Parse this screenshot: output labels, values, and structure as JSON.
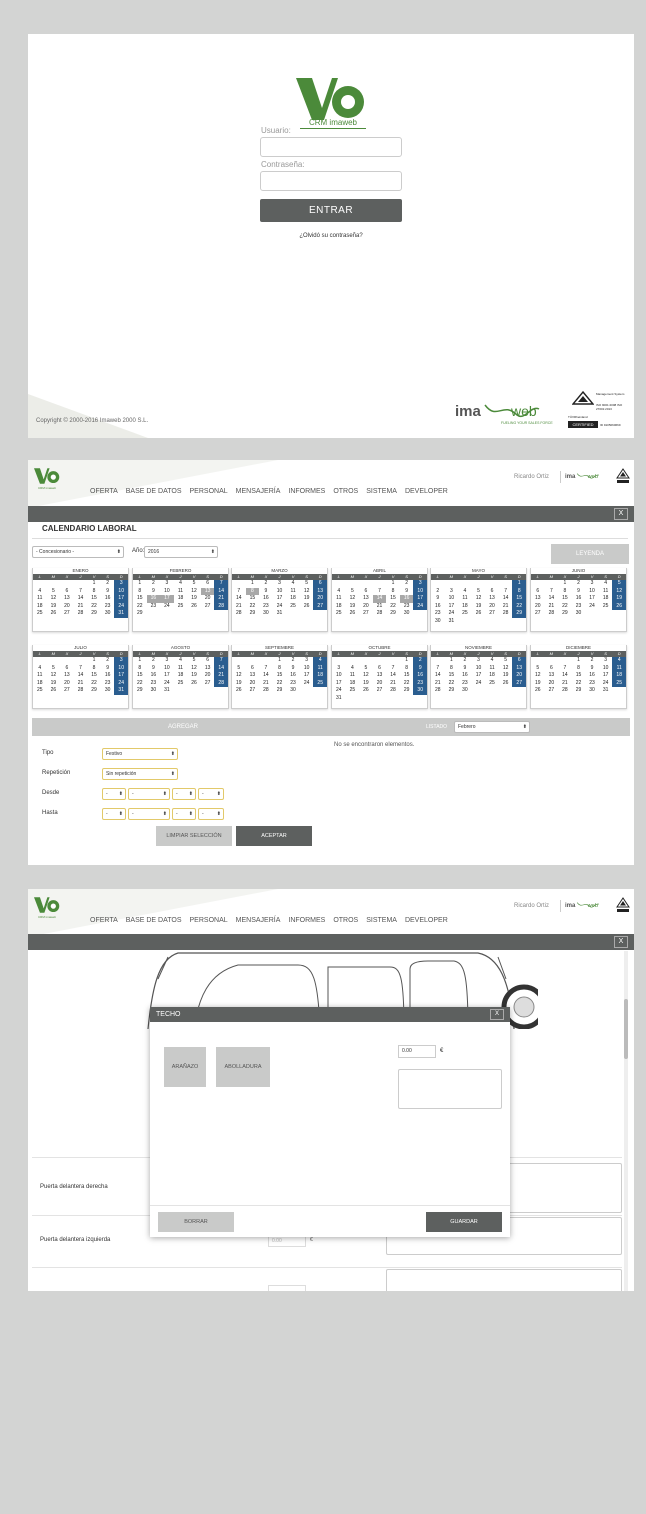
{
  "login": {
    "crm_label": "CRM imaweb",
    "user_label": "Usuario:",
    "password_label": "Contraseña:",
    "enter_button": "ENTRAR",
    "forgot_link": "¿Olvidó su contraseña?",
    "copyright": "Copyright © 2000-2016 Imaweb 2000 S.L.",
    "footer_tagline": "FUELING YOUR SALES FORCE",
    "cert_label": "CERTIFIED",
    "cert_body": "TÜVRheinland",
    "cert_system": "Management System",
    "cert_iso": "ISO 9001:2008 ISO 27001:2013",
    "cert_id": "ID 9105060669"
  },
  "header": {
    "logo_caption": "CRM imaweb",
    "nav_items": [
      "OFERTA",
      "BASE DE DATOS",
      "PERSONAL",
      "MENSAJERÍA",
      "INFORMES",
      "OTROS",
      "SISTEMA",
      "DEVELOPER"
    ],
    "user": "Ricardo Ortiz",
    "close_label": "X"
  },
  "calendar": {
    "title": "CALENDARIO LABORAL",
    "concesionario_select": "- Concesionario -",
    "year_label": "Año:",
    "year_value": "2016",
    "leyenda_button": "LEYENDA",
    "weekdays": [
      "L",
      "M",
      "X",
      "J",
      "V",
      "S",
      "D"
    ],
    "months": [
      {
        "name": "ENERO",
        "offset": 4,
        "days": 31,
        "holidays": []
      },
      {
        "name": "FEBRERO",
        "offset": 0,
        "days": 29,
        "holidays": [
          13,
          16,
          17
        ]
      },
      {
        "name": "MARZO",
        "offset": 1,
        "days": 31,
        "holidays": [
          8
        ]
      },
      {
        "name": "ABRIL",
        "offset": 4,
        "days": 30,
        "holidays": [
          14,
          16
        ]
      },
      {
        "name": "MAYO",
        "offset": 6,
        "days": 31,
        "holidays": []
      },
      {
        "name": "JUNIO",
        "offset": 2,
        "days": 30,
        "holidays": []
      },
      {
        "name": "JULIO",
        "offset": 4,
        "days": 31,
        "holidays": []
      },
      {
        "name": "AGOSTO",
        "offset": 0,
        "days": 31,
        "holidays": []
      },
      {
        "name": "SEPTIEMBRE",
        "offset": 3,
        "days": 30,
        "holidays": []
      },
      {
        "name": "OCTUBRE",
        "offset": 5,
        "days": 31,
        "holidays": []
      },
      {
        "name": "NOVIEMBRE",
        "offset": 1,
        "days": 30,
        "holidays": []
      },
      {
        "name": "DICIEMBRE",
        "offset": 3,
        "days": 31,
        "holidays": []
      }
    ],
    "agregar_label": "AGREGAR",
    "listado_label": "LISTADO",
    "listado_value": "Febrero",
    "no_elements": "No se encontraron elementos.",
    "form": {
      "tipo_label": "Tipo",
      "tipo_value": "Festivo",
      "repeticion_label": "Repetición",
      "repeticion_value": "Sin repetición",
      "desde_label": "Desde",
      "hasta_label": "Hasta",
      "dash": "-",
      "limpiar_button": "LIMPIAR SELECCIÓN",
      "aceptar_button": "ACEPTAR"
    }
  },
  "damage": {
    "modal_title": "TECHO",
    "modal_close": "X",
    "scratch_button": "ARAÑAZO",
    "dent_button": "ABOLLADURA",
    "price_value": "0.00",
    "currency": "€",
    "borrar_button": "BORRAR",
    "guardar_button": "GUARDAR",
    "rows": [
      {
        "label": "Puerta delantera derecha",
        "value": "0.00"
      },
      {
        "label": "Puerta delantera izquierda",
        "value": "0.00"
      }
    ]
  }
}
